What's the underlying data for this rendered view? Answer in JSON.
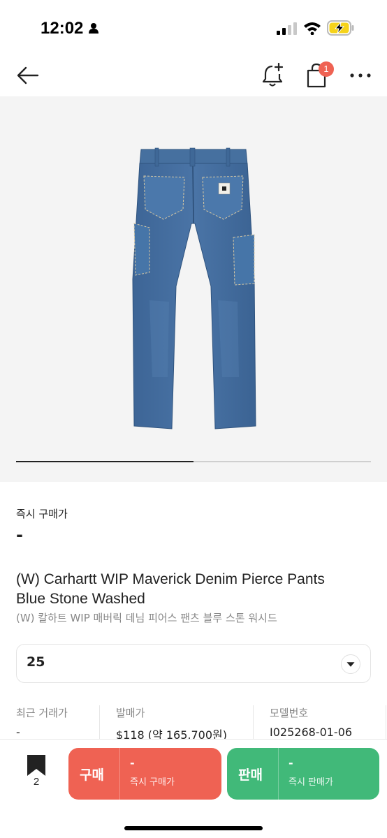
{
  "status_bar": {
    "time": "12:02"
  },
  "nav": {
    "cart_badge": "1"
  },
  "image": {
    "progress": 0.5
  },
  "price": {
    "label": "즉시 구매가",
    "value": "-"
  },
  "product": {
    "title_en_line1": "(W) Carhartt WIP Maverick Denim Pierce Pants",
    "title_en_line2": "Blue Stone Washed",
    "title_ko": "(W) 칼하트 WIP 매버릭 데님 피어스 팬츠 블루 스톤 워시드"
  },
  "size": {
    "selected": "25"
  },
  "info": [
    {
      "label": "최근 거래가",
      "value": "-"
    },
    {
      "label": "발매가",
      "value": "$118 (약 165,700원)"
    },
    {
      "label": "모델번호",
      "value": "I025268-01-06"
    }
  ],
  "bottom": {
    "bookmark_count": "2",
    "buy": {
      "label": "구매",
      "price": "-",
      "sub": "즉시 구매가"
    },
    "sell": {
      "label": "판매",
      "price": "-",
      "sub": "즉시 판매가"
    }
  },
  "colors": {
    "buy": "#ef6253",
    "sell": "#41b979",
    "badge": "#ef6253"
  }
}
